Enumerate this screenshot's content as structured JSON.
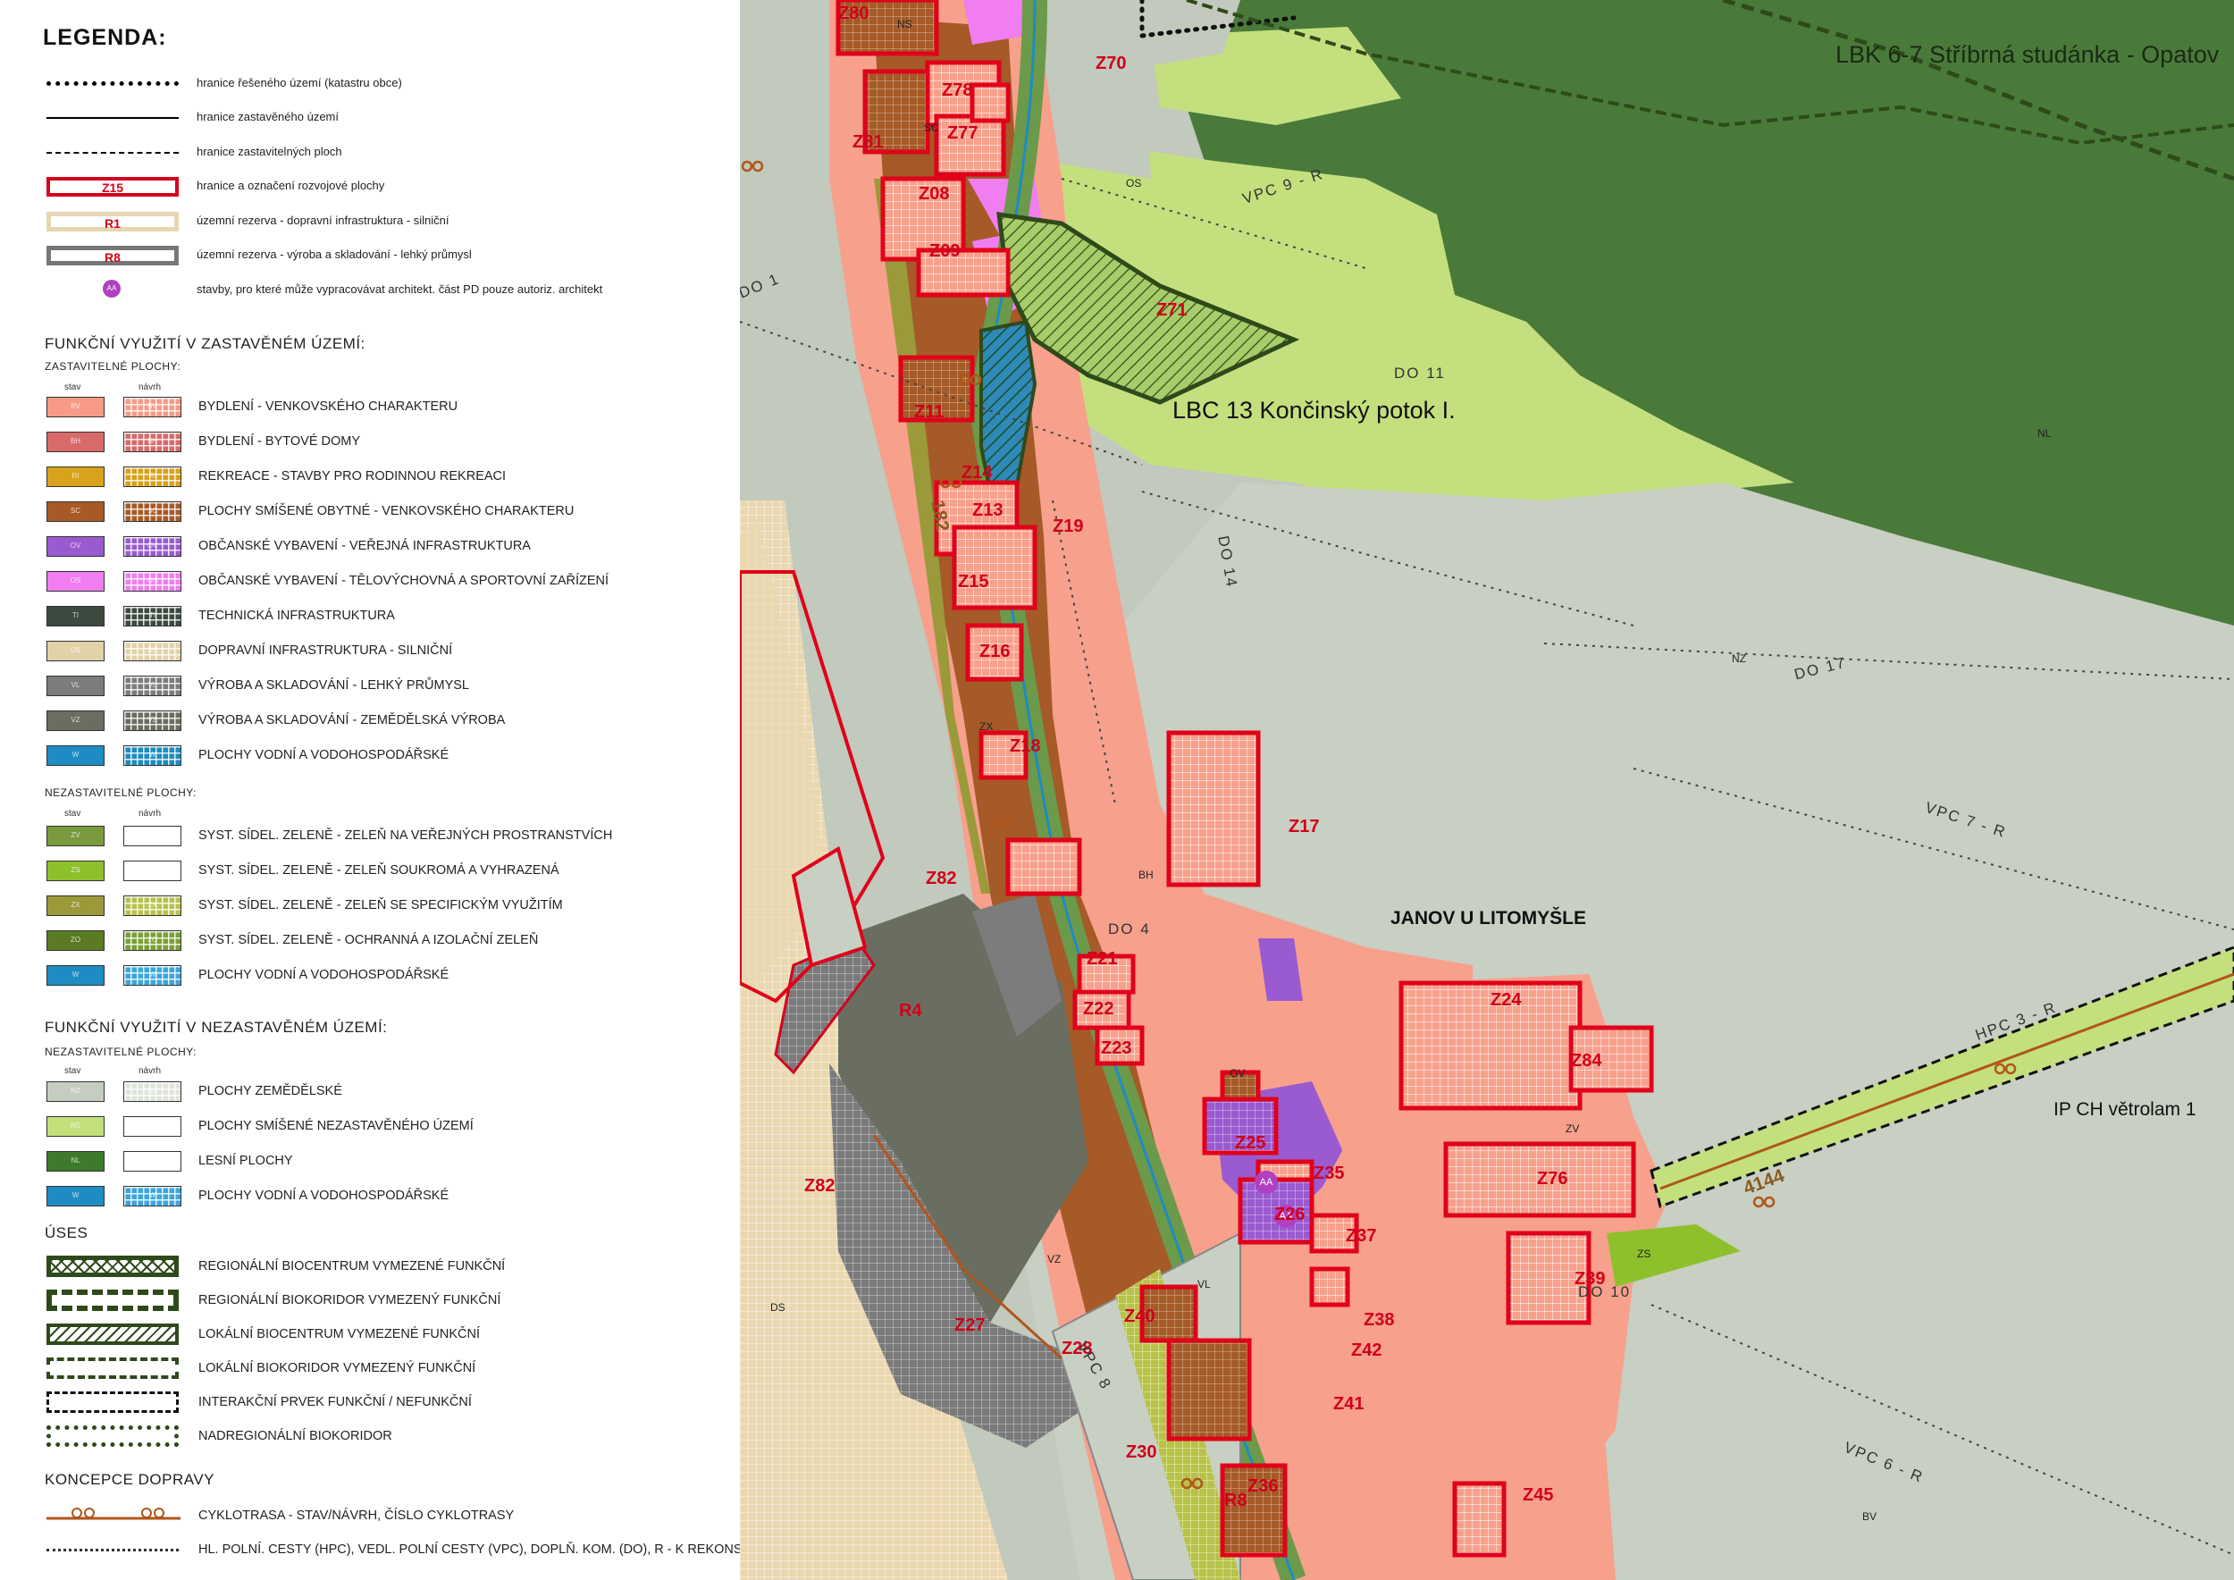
{
  "legend": {
    "title": "LEGENDA:",
    "lines": [
      {
        "label": "hranice řešeného území (katastru obce)",
        "style": "dots"
      },
      {
        "label": "hranice zastavěného území",
        "style": "solid"
      },
      {
        "label": "hranice zastavitelných ploch",
        "style": "dashed"
      },
      {
        "label": "hranice a označení rozvojové plochy",
        "box": "Z15",
        "style": "red-box"
      },
      {
        "label": "územní rezerva - dopravní infrastruktura - silniční",
        "box": "R1",
        "style": "tan-box"
      },
      {
        "label": "územní rezerva - výroba a skladování - lehký průmysl",
        "box": "R8",
        "style": "grey-box"
      },
      {
        "label": "stavby, pro které může vypracovávat architekt. část  PD pouze autoriz. architekt",
        "box": "AA",
        "style": "aa-circle"
      }
    ],
    "section1": {
      "title": "FUNKČNÍ VYUŽITÍ V ZASTAVĚNÉM ÚZEMÍ:",
      "subtitle": "ZASTAVITELNÉ PLOCHY:",
      "col_stav": "stav",
      "col_navrh": "návrh"
    },
    "zastavitelne": [
      {
        "code": "BV",
        "label": "BYDLENÍ - VENKOVSKÉHO CHARAKTERU",
        "color": "#f79a86"
      },
      {
        "code": "BH",
        "label": "BYDLENÍ - BYTOVÉ DOMY",
        "color": "#d96a6a"
      },
      {
        "code": "RI",
        "label": "REKREACE - STAVBY PRO RODINNOU REKREACI",
        "color": "#d8a21a"
      },
      {
        "code": "SC",
        "label": "PLOCHY SMÍŠENÉ OBYTNÉ - VENKOVSKÉHO CHARAKTERU",
        "color": "#a85a26"
      },
      {
        "code": "OV",
        "label": "OBČANSKÉ VYBAVENÍ - VEŘEJNÁ INFRASTRUKTURA",
        "color": "#9a5ad0"
      },
      {
        "code": "OS",
        "label": "OBČANSKÉ VYBAVENÍ - TĚLOVÝCHOVNÁ A SPORTOVNÍ ZAŘÍZENÍ",
        "color": "#f07ef0"
      },
      {
        "code": "TI",
        "label": "TECHNICKÁ INFRASTRUKTURA",
        "color": "#3c4a40"
      },
      {
        "code": "DS",
        "label": "DOPRAVNÍ INFRASTRUKTURA - SILNIČNÍ",
        "color": "#e2d2a8"
      },
      {
        "code": "VL",
        "label": "VÝROBA A SKLADOVÁNÍ - LEHKÝ PRŮMYSL",
        "color": "#7c7c7c"
      },
      {
        "code": "VZ",
        "label": "VÝROBA A SKLADOVÁNÍ - ZEMĚDĚLSKÁ VÝROBA",
        "color": "#6a6e60"
      },
      {
        "code": "W",
        "label": "PLOCHY VODNÍ A VODOHOSPODÁŘSKÉ",
        "color": "#1e8cc2"
      }
    ],
    "nezastavitelne_sub": "NEZASTAVITELNÉ PLOCHY:",
    "nezastavitelne": [
      {
        "code": "ZV",
        "label": "SYST. SÍDEL. ZELENĚ - ZELEŇ NA VEŘEJNÝCH PROSTRANSTVÍCH",
        "color": "#7a9a3e",
        "navrh": ""
      },
      {
        "code": "ZS",
        "label": "SYST. SÍDEL. ZELENĚ  - ZELEŇ SOUKROMÁ A VYHRAZENÁ",
        "color": "#8ec02c",
        "navrh": ""
      },
      {
        "code": "ZX",
        "label": "SYST. SÍDEL. ZELENĚ - ZELEŇ SE SPECIFICKÝM VYUŽITÍM",
        "color": "#9a9a3a",
        "navrh": "#b8c24a"
      },
      {
        "code": "ZO",
        "label": "SYST. SÍDEL. ZELENĚ - OCHRANNÁ A IZOLAČNÍ ZELEŇ",
        "color": "#5a7a24",
        "navrh": "#7aa034"
      },
      {
        "code": "W",
        "label": "PLOCHY VODNÍ A VODOHOSPODÁŘSKÉ",
        "color": "#1e8cc2",
        "navrh": "#3aa6dc"
      }
    ],
    "section2": {
      "title": "FUNKČNÍ VYUŽITÍ V NEZASTAVĚNÉM ÚZEMÍ:",
      "subtitle": "NEZASTAVITELNÉ PLOCHY:",
      "col_stav": "stav",
      "col_navrh": "návrh"
    },
    "nezastavene": [
      {
        "code": "NZ",
        "label": "PLOCHY ZEMĚDĚLSKÉ",
        "color": "#c5cdc0",
        "navrh": "#dfe5da"
      },
      {
        "code": "NS",
        "label": "PLOCHY SMÍŠENÉ NEZASTAVĚNÉHO ÚZEMÍ",
        "color": "#c2e07a",
        "navrh": ""
      },
      {
        "code": "NL",
        "label": "LESNÍ PLOCHY",
        "color": "#3e7a2e",
        "navrh": ""
      },
      {
        "code": "W",
        "label": "PLOCHY VODNÍ A VODOHOSPODÁŘSKÉ",
        "color": "#1e8cc2",
        "navrh": "#3aa6dc"
      }
    ],
    "uses_title": "ÚSES",
    "uses": [
      {
        "label": "REGIONÁLNÍ BIOCENTRUM VYMEZENÉ FUNKČNÍ",
        "style": "cross"
      },
      {
        "label": "REGIONÁLNÍ BIOKORIDOR VYMEZENÝ FUNKČNÍ",
        "style": "thick-dash"
      },
      {
        "label": "LOKÁLNÍ BIOCENTRUM VYMEZENÉ FUNKČNÍ",
        "style": "hatch"
      },
      {
        "label": "LOKÁLNÍ BIOKORIDOR VYMEZENÝ FUNKČNÍ",
        "style": "dash"
      },
      {
        "label": "INTERAKČNÍ PRVEK FUNKČNÍ / NEFUNKČNÍ",
        "style": "dash-black"
      },
      {
        "label": "NADREGIONÁLNÍ BIOKORIDOR",
        "style": "dotted"
      }
    ],
    "transport_title": "KONCEPCE DOPRAVY",
    "transport": [
      {
        "label": "CYKLOTRASA - STAV/NÁVRH, ČÍSLO CYKLOTRASY",
        "style": "cycle"
      },
      {
        "label": "HL. POLNÍ. CESTY (HPC), VEDL. POLNÍ CESTY (VPC), DOPLŇ. KOM. (DO), R - K REKONSTR.",
        "style": "field-path"
      }
    ]
  },
  "map": {
    "colors": {
      "nz": "#c2c9bd",
      "forest": "#4a7a3a",
      "ns": "#c4e07e",
      "bv": "#f7a08c",
      "sc": "#a55a28",
      "ds": "#ead8b0",
      "red": "#e0001a",
      "water": "#1e8cc2"
    },
    "place_labels": {
      "village": "JANOV U LITOMYŠLE",
      "lbk": "LBK 6-7 Stříbrná studánka - Opatov",
      "lbc": "LBC 13 Končinský potok I.",
      "ipch": "IP CH větrolam 1"
    },
    "zones": [
      "Z80",
      "Z78",
      "Z77",
      "Z81",
      "Z08",
      "Z09",
      "Z11",
      "Z14",
      "Z13",
      "Z15",
      "Z16",
      "Z17",
      "Z18",
      "Z19",
      "Z21",
      "Z22",
      "Z23",
      "Z24",
      "Z25",
      "Z26",
      "Z27",
      "Z28",
      "Z30",
      "Z35",
      "Z37",
      "Z38",
      "Z39",
      "Z40",
      "Z41",
      "Z42",
      "Z45",
      "Z70",
      "Z71",
      "Z76",
      "Z82",
      "Z84",
      "Z36"
    ],
    "zone_main": "Z82",
    "reserves": [
      "R4",
      "R8"
    ],
    "paths": [
      "VPC 9 - R",
      "VPC 7 - R",
      "VPC 6 - R",
      "HPC 3 - R",
      "DO 1",
      "DO 11",
      "DO 14",
      "DO 17",
      "DO 10",
      "VPC 8",
      "DO 4"
    ],
    "roads": [
      "182",
      "4144"
    ],
    "land_codes": [
      "NS",
      "NZ",
      "NL",
      "BV",
      "SC",
      "ZV",
      "ZX",
      "ZS",
      "DS",
      "VZ",
      "VL",
      "BH",
      "OS",
      "OV"
    ],
    "aa": "AA"
  }
}
